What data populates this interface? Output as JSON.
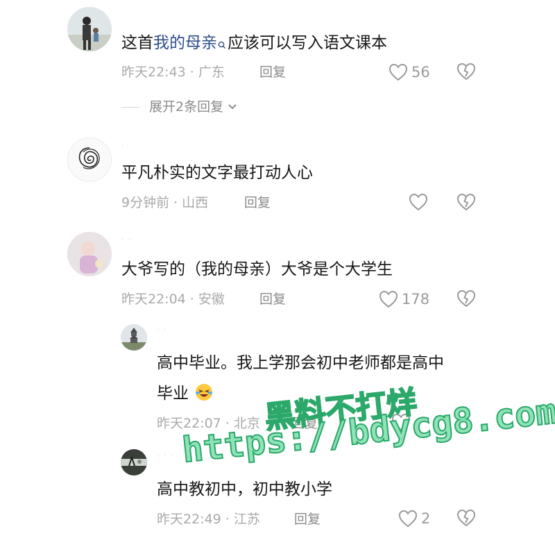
{
  "comments": [
    {
      "text_prefix": "这首",
      "link": "我的母亲",
      "text_suffix": "应该可以写入语文课本",
      "time": "昨天22:43",
      "location": "广东",
      "reply_label": "回复",
      "likes": "56",
      "expand_label": "展开2条回复"
    },
    {
      "text": "平凡朴实的文字最打动人心",
      "time": "9分钟前",
      "location": "山西",
      "reply_label": "回复"
    },
    {
      "text": "大爷写的（我的母亲）大爷是个大学生",
      "time": "昨天22:04",
      "location": "安徽",
      "reply_label": "回复",
      "likes": "178"
    }
  ],
  "replies": [
    {
      "text_line1": "高中毕业。我上学那会初中老师都是高中",
      "text_line2": "毕业",
      "time": "昨天22:07",
      "location": "北京",
      "reply_label": "回复"
    },
    {
      "text": "高中教初中，初中教小学",
      "time": "昨天22:49",
      "location": "江苏",
      "reply_label": "回复",
      "likes": "2"
    }
  ],
  "watermark": {
    "line1": "黑料不打烊",
    "line2": "https://bdycg8.com"
  },
  "colors": {
    "link": "#2f4e8a",
    "watermark_fill": "#8fe3b7",
    "watermark_stroke": "#2ba86a"
  },
  "icons": [
    "search-icon",
    "heart-icon",
    "dislike-heart-icon",
    "chevron-down-icon",
    "laughing-emoji-icon"
  ]
}
